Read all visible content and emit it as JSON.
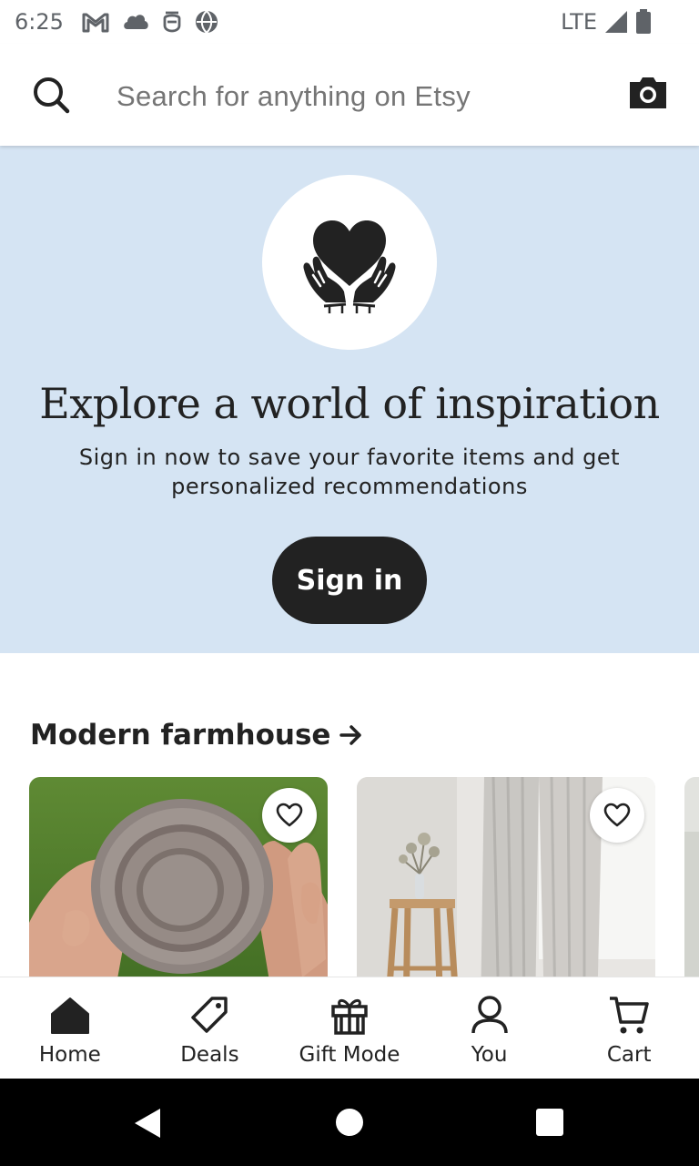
{
  "status_bar": {
    "time": "6:25",
    "network": "LTE",
    "icons": [
      "gmail-icon",
      "cloud-icon",
      "app-icon",
      "basketball-icon",
      "signal-icon",
      "battery-icon"
    ]
  },
  "search": {
    "placeholder": "Search for anything on Etsy",
    "value": ""
  },
  "hero": {
    "title": "Explore a world of inspiration",
    "subtitle": "Sign in now to save your favorite items and get personalized recommendations",
    "button_label": "Sign in",
    "icon": "heart-hands-icon",
    "background": "#d5e4f3"
  },
  "section": {
    "title": "Modern farmhouse",
    "arrow_icon": "arrow-right-icon"
  },
  "cards": [
    {
      "image": "stacked-ceramic-plates-in-hands",
      "favorite_icon": "heart-outline-icon"
    },
    {
      "image": "linen-curtains-with-stool",
      "favorite_icon": "heart-outline-icon"
    }
  ],
  "bottom_nav": {
    "items": [
      {
        "label": "Home",
        "icon": "home-icon",
        "active": true
      },
      {
        "label": "Deals",
        "icon": "tag-icon"
      },
      {
        "label": "Gift Mode",
        "icon": "gift-icon"
      },
      {
        "label": "You",
        "icon": "person-icon"
      },
      {
        "label": "Cart",
        "icon": "cart-icon"
      }
    ]
  },
  "colors": {
    "primary_text": "#222222",
    "hero_background": "#d5e4f3",
    "button_background": "#222222"
  }
}
